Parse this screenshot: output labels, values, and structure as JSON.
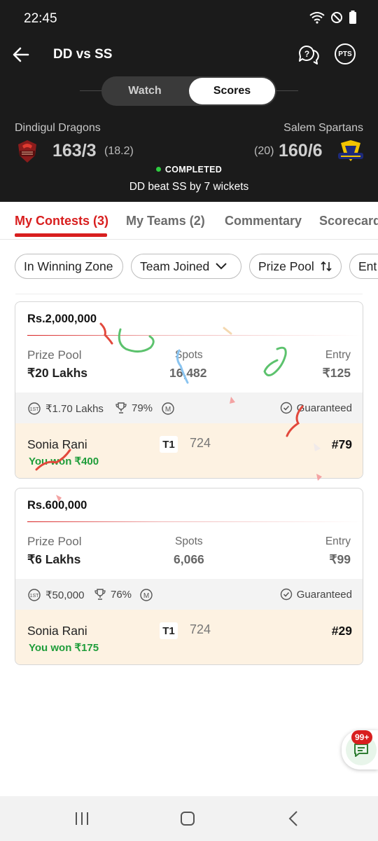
{
  "status_bar": {
    "time": "22:45"
  },
  "header": {
    "title": "DD vs SS",
    "pts_label": "PTS",
    "toggle": {
      "watch": "Watch",
      "scores": "Scores"
    },
    "team_left": {
      "name": "Dindigul Dragons",
      "score": "163/3",
      "overs": "(18.2)"
    },
    "team_right": {
      "name": "Salem Spartans",
      "score": "160/6",
      "overs": "(20)"
    },
    "status": "COMPLETED",
    "result": "DD beat SS by 7 wickets"
  },
  "tabs": [
    "My Contests (3)",
    "My Teams (2)",
    "Commentary",
    "Scorecard"
  ],
  "filters": [
    "In Winning Zone",
    "Team Joined",
    "Prize Pool",
    "Ent"
  ],
  "contests": [
    {
      "title": "Rs.2,000,000",
      "prize_pool_label": "Prize Pool",
      "prize_pool": "₹20 Lakhs",
      "spots_label": "Spots",
      "spots": "16,482",
      "entry_label": "Entry",
      "entry": "₹125",
      "first_prize": "₹1.70 Lakhs",
      "win_percent": "79%",
      "multi_label": "M",
      "guaranteed": "Guaranteed",
      "user": {
        "name": "Sonia Rani",
        "won": "You won ₹400",
        "team": "T1",
        "points": "724",
        "rank": "#79"
      }
    },
    {
      "title": "Rs.600,000",
      "prize_pool_label": "Prize Pool",
      "prize_pool": "₹6 Lakhs",
      "spots_label": "Spots",
      "spots": "6,066",
      "entry_label": "Entry",
      "entry": "₹99",
      "first_prize": "₹50,000",
      "win_percent": "76%",
      "multi_label": "M",
      "guaranteed": "Guaranteed",
      "user": {
        "name": "Sonia Rani",
        "won": "You won ₹175",
        "team": "T1",
        "points": "724",
        "rank": "#29"
      }
    }
  ],
  "chat": {
    "badge": "99+"
  },
  "colors": {
    "accent": "#d81e1e",
    "header_bg": "#1b1b1b",
    "win_green": "#1f9d3a",
    "user_row_bg": "#fdf2e2"
  }
}
